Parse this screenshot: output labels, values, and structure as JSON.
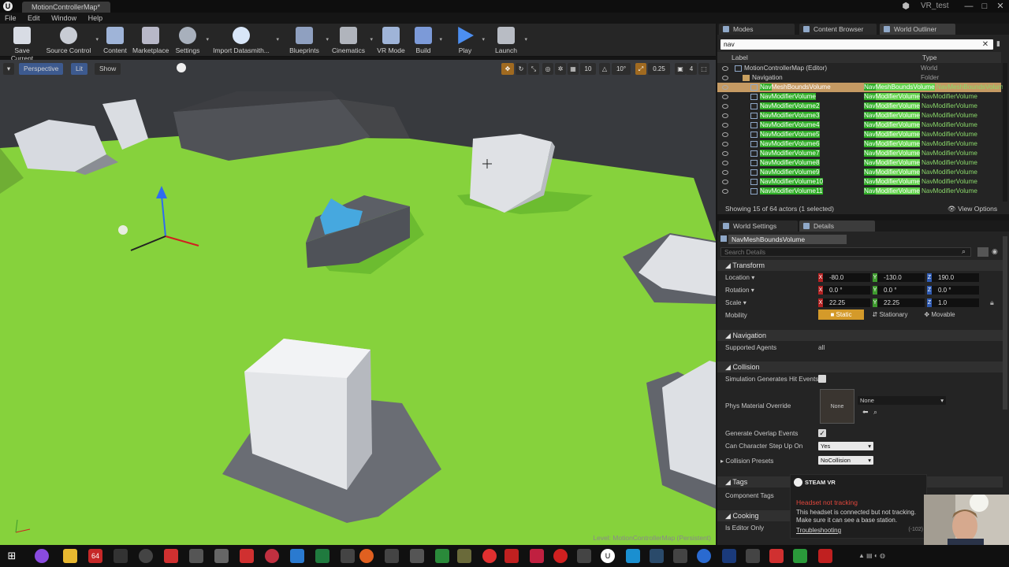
{
  "window": {
    "tab_title": "MotionControllerMap*",
    "project_name": "VR_test",
    "minimize": "—",
    "maximize": "□",
    "close": "✕"
  },
  "menu": [
    "File",
    "Edit",
    "Window",
    "Help"
  ],
  "toolbar": {
    "buttons": [
      {
        "label": "Save Current",
        "icon": "save-icon"
      },
      {
        "label": "Source Control",
        "icon": "source-control-icon"
      },
      {
        "label": "Content",
        "icon": "content-icon"
      },
      {
        "label": "Marketplace",
        "icon": "marketplace-icon"
      },
      {
        "label": "Settings",
        "icon": "settings-icon"
      },
      {
        "label": "Import Datasmith...",
        "icon": "datasmith-icon"
      },
      {
        "label": "Blueprints",
        "icon": "blueprints-icon"
      },
      {
        "label": "Cinematics",
        "icon": "cinematics-icon"
      },
      {
        "label": "VR Mode",
        "icon": "vr-mode-icon"
      },
      {
        "label": "Build",
        "icon": "build-icon"
      },
      {
        "label": "Play",
        "icon": "play-icon"
      },
      {
        "label": "Launch",
        "icon": "launch-icon"
      }
    ]
  },
  "viewport": {
    "perspective": "Perspective",
    "lit": "Lit",
    "show": "Show",
    "grid_snap": "10",
    "rotation_snap": "10°",
    "scale_snap": "0.25",
    "camera_speed": "4",
    "level_label": "Level:  MotionControllerMap (Persistent)"
  },
  "panel_tabs": {
    "modes": "Modes",
    "content_browser": "Content Browser",
    "world_outliner": "World Outliner"
  },
  "outliner": {
    "search_value": "nav",
    "col_label": "Label",
    "col_type": "Type",
    "rows": [
      {
        "label": "MotionControllerMap (Editor)",
        "type": "World",
        "hl": "",
        "indent": 0
      },
      {
        "label": "Navigation",
        "type": "Folder",
        "hl": "",
        "indent": 1
      },
      {
        "label": "NavMeshBoundsVolume",
        "type": "NavMeshBoundsVolume",
        "hl": "Nav",
        "indent": 2,
        "selected": true
      },
      {
        "label": "NavModifierVolume",
        "type": "NavModifierVolume",
        "hl": "Nav",
        "indent": 2
      },
      {
        "label": "NavModifierVolume2",
        "type": "NavModifierVolume",
        "hl": "Nav",
        "indent": 2
      },
      {
        "label": "NavModifierVolume3",
        "type": "NavModifierVolume",
        "hl": "Nav",
        "indent": 2
      },
      {
        "label": "NavModifierVolume4",
        "type": "NavModifierVolume",
        "hl": "Nav",
        "indent": 2
      },
      {
        "label": "NavModifierVolume5",
        "type": "NavModifierVolume",
        "hl": "Nav",
        "indent": 2
      },
      {
        "label": "NavModifierVolume6",
        "type": "NavModifierVolume",
        "hl": "Nav",
        "indent": 2
      },
      {
        "label": "NavModifierVolume7",
        "type": "NavModifierVolume",
        "hl": "Nav",
        "indent": 2
      },
      {
        "label": "NavModifierVolume8",
        "type": "NavModifierVolume",
        "hl": "Nav",
        "indent": 2
      },
      {
        "label": "NavModifierVolume9",
        "type": "NavModifierVolume",
        "hl": "Nav",
        "indent": 2
      },
      {
        "label": "NavModifierVolume10",
        "type": "NavModifierVolume",
        "hl": "Nav",
        "indent": 2
      },
      {
        "label": "NavModifierVolume11",
        "type": "NavModifierVolume",
        "hl": "Nav",
        "indent": 2
      }
    ],
    "footer": "Showing 15 of 64 actors (1 selected)",
    "view_options": "View Options"
  },
  "details": {
    "tab_world_settings": "World Settings",
    "tab_details": "Details",
    "actor_name": "NavMeshBoundsVolume",
    "search_placeholder": "Search Details",
    "transform": {
      "section": "Transform",
      "location_label": "Location",
      "rotation_label": "Rotation",
      "scale_label": "Scale",
      "location": [
        "-80.0",
        "-130.0",
        "190.0"
      ],
      "rotation": [
        "0.0 °",
        "0.0 °",
        "0.0 °"
      ],
      "scale": [
        "22.25",
        "22.25",
        "1.0"
      ],
      "mobility_label": "Mobility",
      "mobility_options": [
        "Static",
        "Stationary",
        "Movable"
      ]
    },
    "navigation": {
      "section": "Navigation",
      "supported_agents_label": "Supported Agents",
      "supported_agents_value": "all"
    },
    "collision": {
      "section": "Collision",
      "sim_hit_label": "Simulation Generates Hit Events",
      "phys_mat_label": "Phys Material Override",
      "phys_mat_thumb": "None",
      "phys_mat_value": "None",
      "overlap_label": "Generate Overlap Events",
      "step_up_label": "Can Character Step Up On",
      "step_up_value": "Yes",
      "presets_label": "Collision Presets",
      "presets_value": "NoCollision"
    },
    "tags": {
      "section": "Tags",
      "component_tags_label": "Component Tags"
    },
    "cooking": {
      "section": "Cooking",
      "editor_only_label": "Is Editor Only"
    }
  },
  "steamvr": {
    "brand": "STEAM VR",
    "title": "Headset not tracking",
    "message": "This headset is connected but not tracking. Make sure it can see a base station.",
    "link": "Troubleshooting",
    "code": "(-102)"
  },
  "colors": {
    "accent_orange": "#c59a63",
    "nav_green": "#7fd23a",
    "steam_error": "#e0463c"
  }
}
